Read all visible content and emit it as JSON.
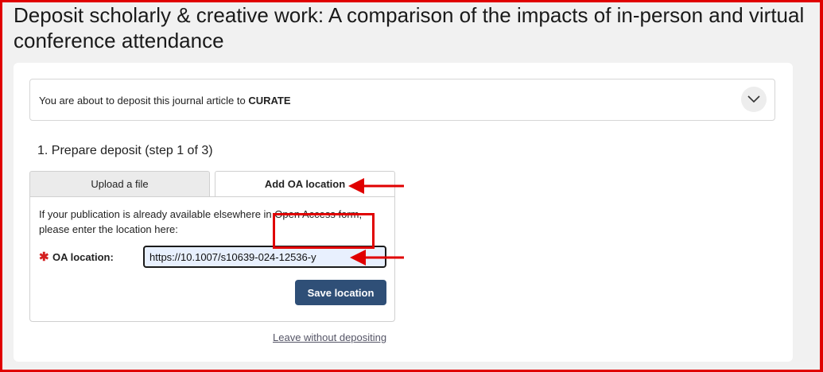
{
  "page": {
    "title": "Deposit scholarly & creative work: A comparison of the impacts of in-person and virtual conference attendance"
  },
  "notice": {
    "prefix": "You are about to deposit this journal article to ",
    "repository": "CURATE"
  },
  "step": {
    "title": "1. Prepare deposit (step 1 of 3)"
  },
  "tabs": [
    {
      "label": "Upload a file",
      "active": false
    },
    {
      "label": "Add OA location",
      "active": true
    }
  ],
  "form": {
    "help_text": "If your publication is already available elsewhere in Open Access form, please enter the location here:",
    "required_marker": "✱",
    "oa_label": "OA location:",
    "oa_value": "https://10.1007/s10639-024-12536-y",
    "save_label": "Save location"
  },
  "links": {
    "leave": "Leave without depositing"
  },
  "icons": {
    "expand": "chevron-down-icon",
    "annotation": "red-arrow-icon"
  },
  "colors": {
    "accent": "#2f4f77",
    "annotation": "#e00000",
    "required": "#d42020"
  }
}
